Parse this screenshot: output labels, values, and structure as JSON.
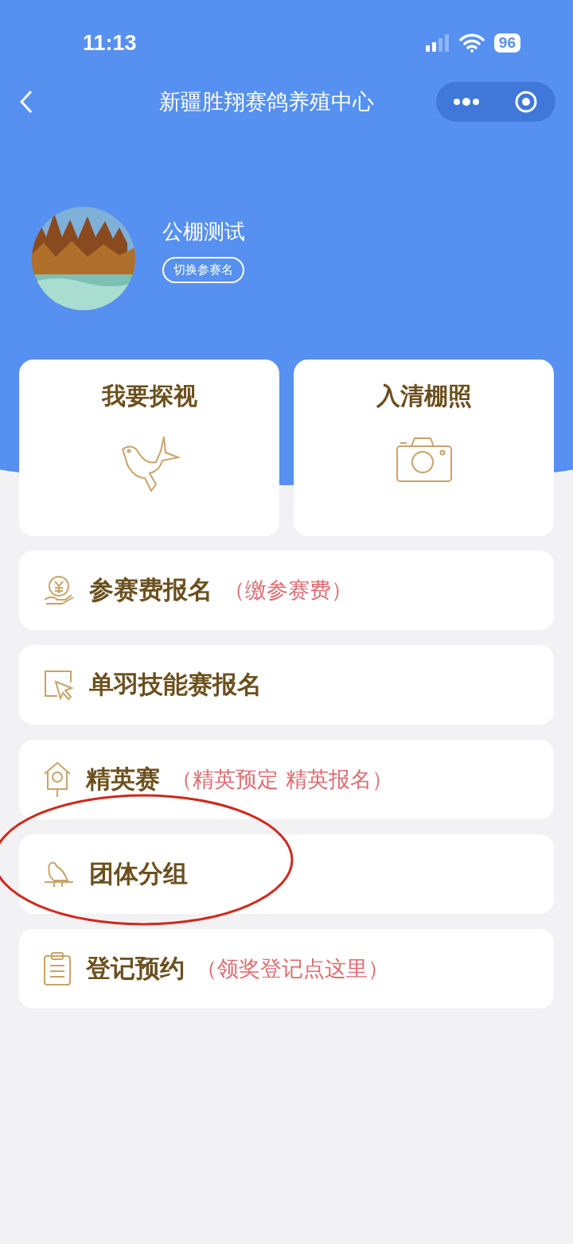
{
  "status_bar": {
    "time": "11:13",
    "battery": "96"
  },
  "nav": {
    "title": "新疆胜翔赛鸽养殖中心"
  },
  "profile": {
    "name": "公棚测试",
    "switch_button": "切换参赛名"
  },
  "tiles": [
    {
      "label": "我要探视",
      "kind": "dove"
    },
    {
      "label": "入清棚照",
      "kind": "camera"
    }
  ],
  "menu": [
    {
      "kind": "money",
      "label": "参赛费报名",
      "note": "（缴参赛费）",
      "circled": false
    },
    {
      "kind": "cursor",
      "label": "单羽技能赛报名",
      "circled": false
    },
    {
      "kind": "birdhouse",
      "label": "精英赛",
      "note": "（精英预定 精英报名）",
      "circled": false
    },
    {
      "kind": "bird",
      "label": "团体分组",
      "circled": true
    },
    {
      "kind": "clipboard",
      "label": "登记预约",
      "note": "（领奖登记点这里）",
      "circled": false
    }
  ]
}
